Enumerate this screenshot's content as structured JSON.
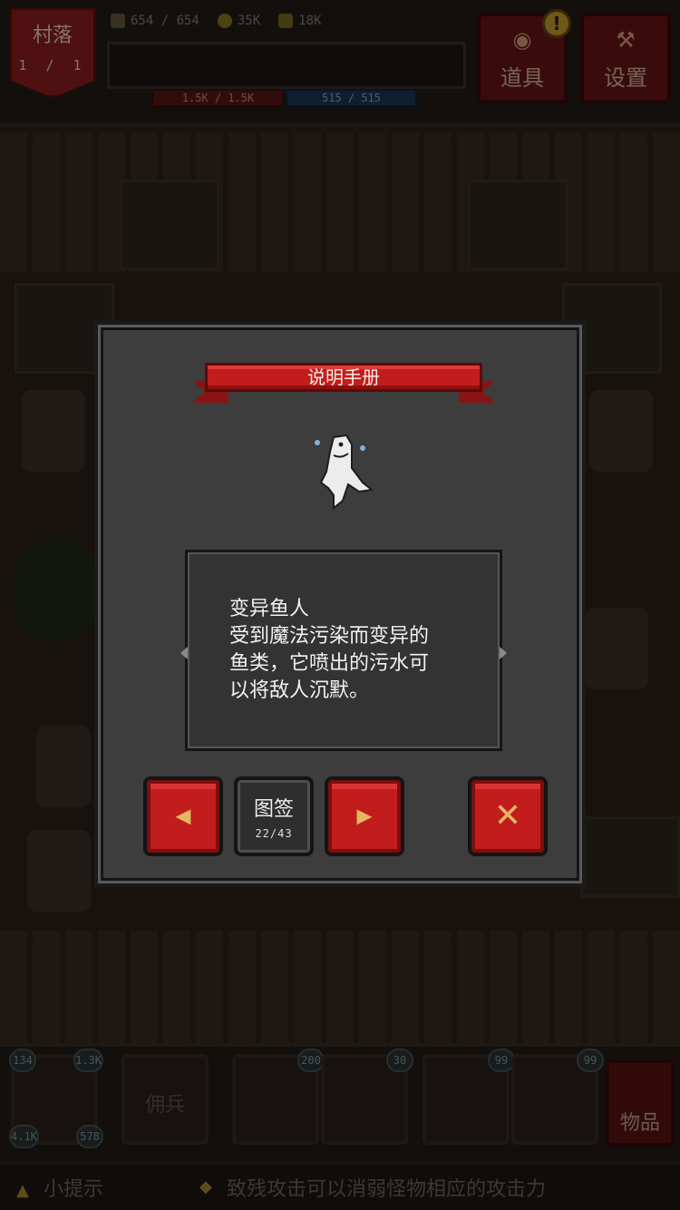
{
  "topbar": {
    "village_label": "村落",
    "village_level": "1 / 1",
    "stat_a": "654 / 654",
    "stat_b": "35K",
    "stat_c": "18K",
    "hp": "1.5K / 1.5K",
    "mp": "515 / 515",
    "items_button": "道具",
    "settings_button": "设置",
    "alert_symbol": "!"
  },
  "bottombar": {
    "hero_level_badge": "134",
    "hero_stat_badge": "1.3K",
    "hero_stat2_badge": "4.1K",
    "hero_stat3_badge": "578",
    "mercenary_slot": "佣兵",
    "skill1_badge": "200",
    "skill2_badge": "30",
    "potion1_badge": "99",
    "potion2_badge": "99",
    "inventory_button": "物品"
  },
  "hintbar": {
    "label": "小提示",
    "text": "致残攻击可以消弱怪物相应的攻击力"
  },
  "dialog": {
    "title": "说明手册",
    "description_lines": [
      "变异鱼人",
      "受到魔法污染而变异的",
      "鱼类，它喷出的污水可",
      "以将敌人沉默。"
    ],
    "prev_symbol": "◀",
    "next_symbol": "▶",
    "close_symbol": "✕",
    "catalog_label": "图签",
    "catalog_count": "22/43"
  },
  "icons": {
    "creature": "mutant-fishman-icon",
    "prev": "left-arrow-icon",
    "next": "right-arrow-icon",
    "close": "close-icon"
  },
  "colors": {
    "banner_red": "#c21d1d",
    "button_red": "#c21d1d",
    "arrow_gold": "#e3b862",
    "panel_gray": "#3d3d3d"
  }
}
